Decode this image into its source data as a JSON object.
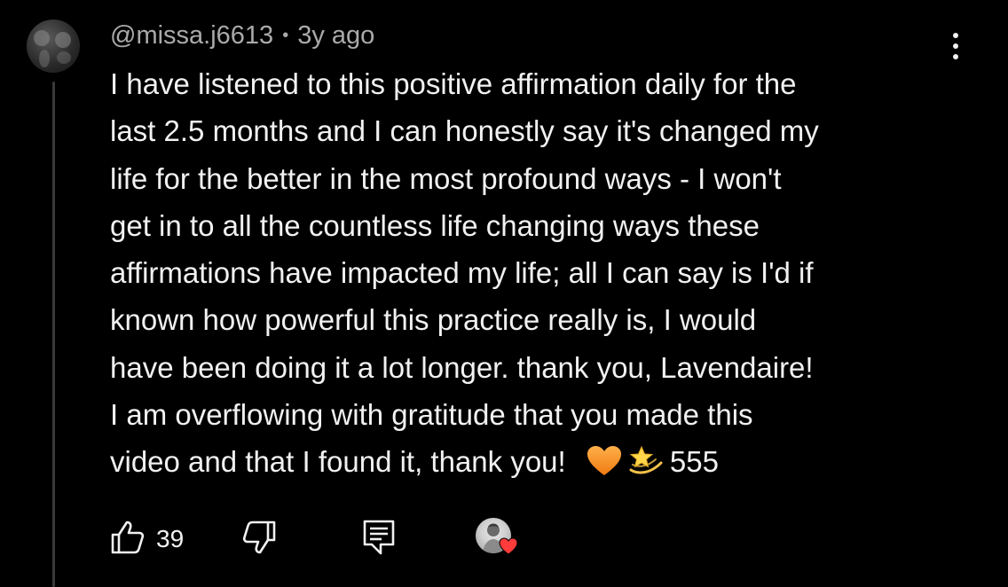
{
  "comment": {
    "username": "@missa.j6613",
    "separator": "•",
    "timestamp": "3y ago",
    "text_lines": [
      "I have listened to this positive affirmation daily for the",
      "last 2.5 months and I can honestly say it's changed my",
      "life for the better in the most profound ways - I won't",
      "get in to all the countless life changing ways these",
      "affirmations have impacted my life; all I can say is I'd if",
      "known how powerful this practice really is, I would",
      "have been doing it a lot longer. thank you, Lavendaire!",
      "I am overflowing with gratitude that you made this",
      "video and that I found it, thank you!"
    ],
    "trailing_emojis": [
      "orange-heart",
      "dizzy-star"
    ],
    "trailing_text": "555"
  },
  "actions": {
    "like_count": "39",
    "like_icon": "thumbs-up-icon",
    "dislike_icon": "thumbs-down-icon",
    "reply_icon": "reply-icon",
    "creator_heart_icon": "heart-icon"
  },
  "menu": {
    "icon": "more-vertical-icon"
  },
  "colors": {
    "background": "#000000",
    "text_primary": "#f1f1f1",
    "text_secondary": "#aaaaaa",
    "heart_red": "#ff3b3b",
    "thread_line": "#3a3a3a"
  }
}
